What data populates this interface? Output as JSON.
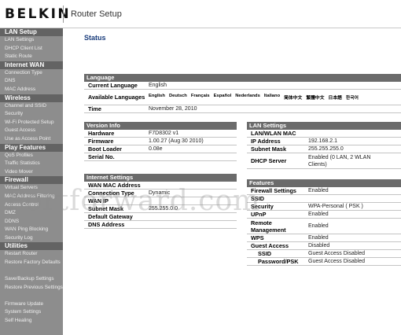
{
  "header": {
    "logo": "BELKIN",
    "title": "Router Setup"
  },
  "sidebar": {
    "sections": [
      {
        "title": "LAN Setup",
        "items": [
          "LAN Settings",
          "DHCP Client List",
          "Static Route"
        ]
      },
      {
        "title": "Internet WAN",
        "items": [
          "Connection Type",
          "DNS",
          "MAC Address"
        ]
      },
      {
        "title": "Wireless",
        "items": [
          "Channel and SSID",
          "Security",
          "Wi-Fi Protected Setup",
          "Guest Access",
          "Use as Access Point"
        ]
      },
      {
        "title": "Play Features",
        "items": [
          "QoS Profiles",
          "Traffic Statistics",
          "Video Mover"
        ]
      },
      {
        "title": "Firewall",
        "items": [
          "Virtual Servers",
          "MAC Address Filtering",
          "Access Control",
          "DMZ",
          "DDNS",
          "WAN Ping Blocking",
          "Security Log"
        ]
      },
      {
        "title": "Utilities",
        "items": [
          "Restart Router",
          "Restore Factory Defaults",
          "Save/Backup Settings",
          "Restore Previous Settings",
          "Firmware Update",
          "System Settings",
          "Self Healing"
        ]
      }
    ]
  },
  "main": {
    "title": "Status",
    "language": {
      "header": "Language",
      "current_label": "Current Language",
      "current_value": "English",
      "available_label": "Available Languages",
      "options": [
        "English",
        "Deutsch",
        "Français",
        "Español",
        "Nederlands",
        "Italiano",
        "简体中文",
        "繁體中文",
        "日本語",
        "한국어"
      ],
      "time_label": "Time",
      "time_value": "November 28, 2010"
    },
    "version": {
      "header": "Version Info",
      "hardware_label": "Hardware",
      "hardware_value": "F7D8302 v1",
      "firmware_label": "Firmware",
      "firmware_value": "1.00.27 (Aug 30 2010)",
      "boot_label": "Boot Loader",
      "boot_value": "0.08e",
      "serial_label": "Serial No.",
      "serial_value": ""
    },
    "lan": {
      "header": "LAN Settings",
      "mac_label": "LAN/WLAN MAC",
      "mac_value": "",
      "ip_label": "IP Address",
      "ip_value": "192.168.2.1",
      "mask_label": "Subnet Mask",
      "mask_value": "255.255.255.0",
      "dhcp_label": "DHCP Server",
      "dhcp_value": "Enabled (0 LAN, 2 WLAN Clients)"
    },
    "internet": {
      "header": "Internet Settings",
      "mac_label": "WAN MAC Address",
      "mac_value": "",
      "conn_label": "Connection Type",
      "conn_value": "Dynamic",
      "ip_label": "WAN IP",
      "ip_value": "",
      "mask_label": "Subnet Mask",
      "mask_value": "255.255.0.0",
      "gw_label": "Default Gateway",
      "gw_value": "",
      "dns_label": "DNS Address",
      "dns_value": ""
    },
    "features": {
      "header": "Features",
      "firewall_label": "Firewall Settings",
      "firewall_value": "Enabled",
      "ssid_label": "SSID",
      "ssid_value": "",
      "security_label": "Security",
      "security_value": "WPA-Personal ( PSK )",
      "upnp_label": "UPnP",
      "upnp_value": "Enabled",
      "remote_label": "Remote Management",
      "remote_value": "Enabled",
      "wps_label": "WPS",
      "wps_value": "Enabled",
      "guest_label": "Guest Access",
      "guest_value": "Disabled",
      "gssid_label": "SSID",
      "gssid_value": "Guest Access Disabled",
      "gpsk_label": "Password/PSK",
      "gpsk_value": "Guest Access Disabled"
    }
  },
  "watermark": "Portforward.com"
}
